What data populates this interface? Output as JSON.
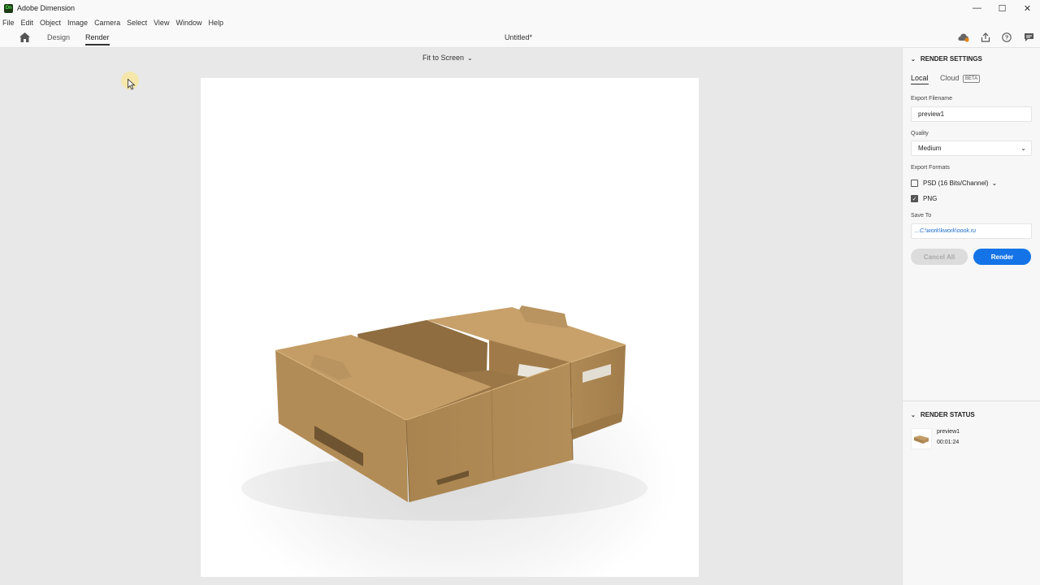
{
  "app": {
    "title": "Adobe Dimension",
    "logo_text": "Dn"
  },
  "window": {
    "minimize": "—",
    "maximize": "☐",
    "close": "✕"
  },
  "menu": [
    "File",
    "Edit",
    "Object",
    "Image",
    "Camera",
    "Select",
    "View",
    "Window",
    "Help"
  ],
  "toolbar": {
    "tabs": [
      {
        "label": "Design",
        "active": false
      },
      {
        "label": "Render",
        "active": true
      }
    ],
    "document_title": "Untitled*",
    "icons": [
      "cloud-sync-icon",
      "share-icon",
      "help-icon",
      "feedback-icon"
    ]
  },
  "viewport": {
    "zoom_label": "Fit to Screen"
  },
  "render_settings": {
    "header": "RENDER SETTINGS",
    "tabs": [
      {
        "label": "Local",
        "active": true
      },
      {
        "label": "Cloud",
        "active": false
      }
    ],
    "cloud_badge": "BETA",
    "export_filename_label": "Export Filename",
    "export_filename_value": "preview1",
    "quality_label": "Quality",
    "quality_value": "Medium",
    "export_formats_label": "Export Formats",
    "formats": [
      {
        "label": "PSD (16 Bits/Channel)",
        "checked": false,
        "has_dropdown": true
      },
      {
        "label": "PNG",
        "checked": true,
        "has_dropdown": false
      }
    ],
    "save_to_label": "Save To",
    "save_to_value": "...C:\\work\\kwork\\oook.ru",
    "cancel_label": "Cancel All",
    "render_label": "Render"
  },
  "render_status": {
    "header": "RENDER STATUS",
    "item_name": "preview1",
    "item_time": "00:01:24"
  },
  "colors": {
    "accent": "#1473e6",
    "cardboard": "#b8915c"
  }
}
